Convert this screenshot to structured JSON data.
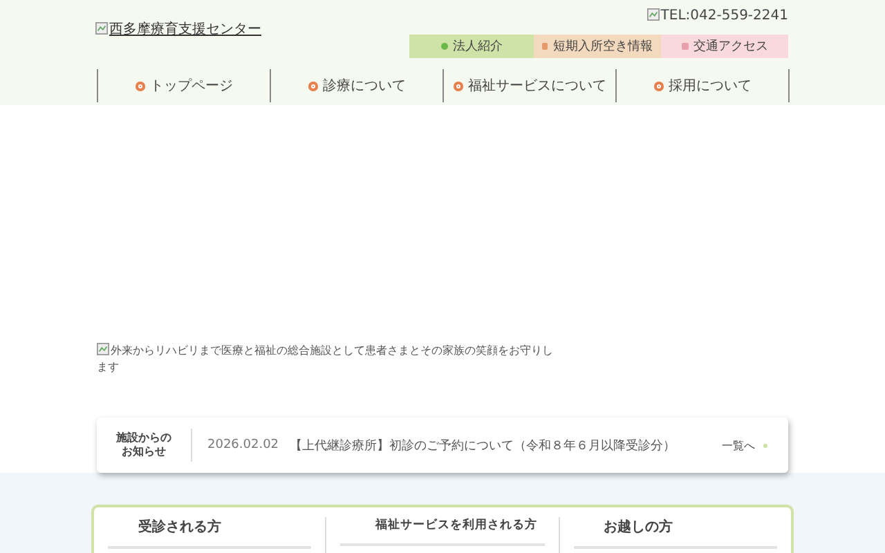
{
  "header": {
    "logo_alt": "西多摩療育支援センター",
    "tel_alt": "TEL:042-559-2241",
    "quick_links": [
      {
        "label": "法人紹介",
        "color": "#cfe3a8"
      },
      {
        "label": "短期入所空き情報",
        "color": "#f3d9bd"
      },
      {
        "label": "交通アクセス",
        "color": "#f9d9dc"
      }
    ]
  },
  "nav": [
    {
      "label": "トップページ"
    },
    {
      "label": "診療について"
    },
    {
      "label": "福祉サービスについて"
    },
    {
      "label": "採用について"
    }
  ],
  "hero": {
    "image_alt": "外来からリハビリまで医療と福祉の総合施設として患者さまとその家族の笑顔をお守りします"
  },
  "news": {
    "heading": "施設からのお知らせ",
    "date": "2026.02.02",
    "title": "【上代継診療所】初診のご予約について（令和８年６月以降受診分）",
    "more": "一覧へ"
  },
  "audiences": [
    {
      "label": "受診される方"
    },
    {
      "label": "福祉サービスを利用される方"
    },
    {
      "label": "お越しの方"
    }
  ]
}
